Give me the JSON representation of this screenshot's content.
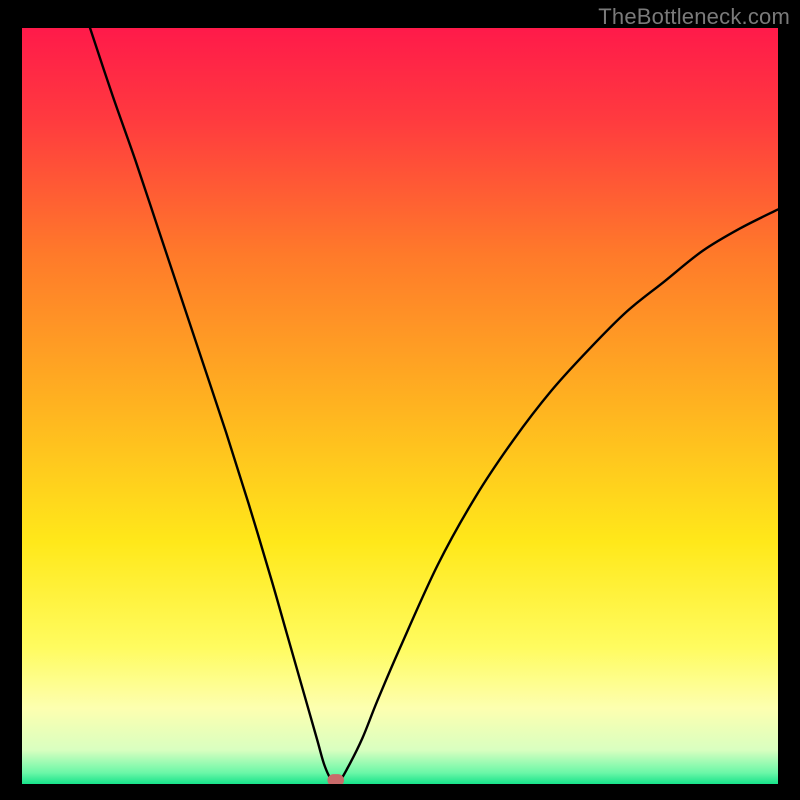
{
  "watermark_text": "TheBottleneck.com",
  "chart_data": {
    "type": "line",
    "title": "",
    "xlabel": "",
    "ylabel": "",
    "xlim": [
      0,
      100
    ],
    "ylim": [
      0,
      100
    ],
    "grid": false,
    "legend": false,
    "background_gradient_stops": [
      {
        "offset": 0.0,
        "color": "#ff1a4a"
      },
      {
        "offset": 0.12,
        "color": "#ff3a3f"
      },
      {
        "offset": 0.3,
        "color": "#ff7a2a"
      },
      {
        "offset": 0.5,
        "color": "#ffb320"
      },
      {
        "offset": 0.68,
        "color": "#ffe81a"
      },
      {
        "offset": 0.82,
        "color": "#fffc60"
      },
      {
        "offset": 0.9,
        "color": "#fdffb0"
      },
      {
        "offset": 0.955,
        "color": "#d9ffc0"
      },
      {
        "offset": 0.985,
        "color": "#6cf7a8"
      },
      {
        "offset": 1.0,
        "color": "#17e38a"
      }
    ],
    "series": [
      {
        "name": "bottleneck-curve",
        "x": [
          9,
          12,
          15,
          18,
          21,
          24,
          27,
          30,
          33,
          35,
          37,
          39,
          40,
          41,
          42,
          43,
          45,
          47,
          50,
          55,
          60,
          65,
          70,
          75,
          80,
          85,
          90,
          95,
          100
        ],
        "y": [
          100,
          91,
          82.5,
          73.5,
          64.5,
          55.5,
          46.5,
          37,
          27,
          20,
          13,
          6,
          2.5,
          0.5,
          0.5,
          2,
          6,
          11,
          18,
          29,
          38,
          45.5,
          52,
          57.5,
          62.5,
          66.5,
          70.5,
          73.5,
          76
        ]
      }
    ],
    "marker": {
      "name": "optimal-point",
      "x": 41.5,
      "y": 0.5,
      "shape": "pill",
      "color": "#c96a6a",
      "width_pct": 2.2,
      "height_pct": 1.6
    }
  }
}
